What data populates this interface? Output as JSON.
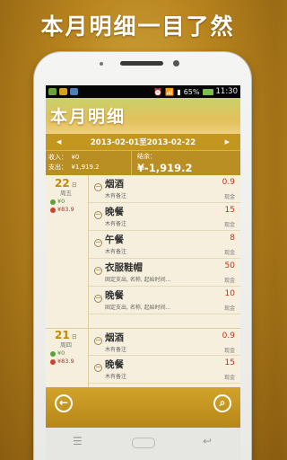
{
  "headline": "本月明细一目了然",
  "status_bar": {
    "wifi": "wifi-icon",
    "signal": "signal-icon",
    "battery_percent": "65%",
    "time": "11:30"
  },
  "app": {
    "title": "本月明细",
    "date_range": "2013-02-01至2013-02-22",
    "prev_arrow": "◀",
    "next_arrow": "▶",
    "income_label": "收入：",
    "income_value": "¥0",
    "expense_label": "支出：",
    "expense_value": "¥1,919.2",
    "balance_label": "结余：",
    "balance_value": "¥-1,919.2"
  },
  "days": [
    {
      "day": "22",
      "unit": "日",
      "weekday": "周五",
      "income": "¥0",
      "expense": "¥83.9",
      "entries": [
        {
          "name": "烟酒",
          "note": "木有备注",
          "amount": "0.9",
          "pay": "现金"
        },
        {
          "name": "晚餐",
          "note": "木有备注",
          "amount": "15",
          "pay": "现金"
        },
        {
          "name": "午餐",
          "note": "木有备注",
          "amount": "8",
          "pay": "现金"
        },
        {
          "name": "衣服鞋帽",
          "note": "固定支出, 名称, 起始时间...",
          "amount": "50",
          "pay": "现金"
        },
        {
          "name": "晚餐",
          "note": "固定支出, 名称, 起始时间...",
          "amount": "10",
          "pay": "现金"
        }
      ]
    },
    {
      "day": "21",
      "unit": "日",
      "weekday": "周四",
      "income": "¥0",
      "expense": "¥83.9",
      "entries": [
        {
          "name": "烟酒",
          "note": "木有备注",
          "amount": "0.9",
          "pay": "现金"
        },
        {
          "name": "晚餐",
          "note": "木有备注",
          "amount": "15",
          "pay": "现金"
        }
      ]
    }
  ],
  "bottom": {
    "back_icon": "back-arrow-icon",
    "search_icon": "search-icon"
  },
  "softkeys": {
    "back": "↩",
    "home": "▭",
    "menu": "☰"
  }
}
